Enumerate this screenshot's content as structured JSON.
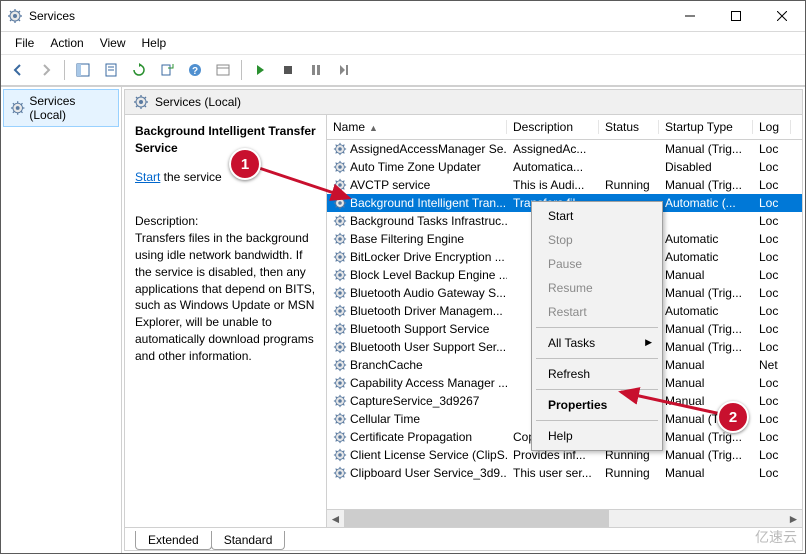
{
  "window": {
    "title": "Services"
  },
  "menubar": [
    "File",
    "Action",
    "View",
    "Help"
  ],
  "tree": {
    "label": "Services (Local)"
  },
  "right_header": "Services (Local)",
  "detail": {
    "selected_name": "Background Intelligent Transfer Service",
    "action_link": "Start",
    "action_suffix": " the service",
    "desc_label": "Description:",
    "description": "Transfers files in the background using idle network bandwidth. If the service is disabled, then any applications that depend on BITS, such as Windows Update or MSN Explorer, will be unable to automatically download programs and other information."
  },
  "columns": {
    "name": "Name",
    "description": "Description",
    "status": "Status",
    "startup": "Startup Type",
    "logon": "Log"
  },
  "services": [
    {
      "name": "AssignedAccessManager Se...",
      "desc": "AssignedAc...",
      "status": "",
      "startup": "Manual (Trig...",
      "logon": "Loc"
    },
    {
      "name": "Auto Time Zone Updater",
      "desc": "Automatica...",
      "status": "",
      "startup": "Disabled",
      "logon": "Loc"
    },
    {
      "name": "AVCTP service",
      "desc": "This is Audi...",
      "status": "Running",
      "startup": "Manual (Trig...",
      "logon": "Loc"
    },
    {
      "name": "Background Intelligent Tran...",
      "desc": "Transfers fil...",
      "status": "",
      "startup": "Automatic (...",
      "logon": "Loc",
      "selected": true
    },
    {
      "name": "Background Tasks Infrastruc...",
      "desc": "",
      "status": "",
      "startup": "",
      "logon": "Loc"
    },
    {
      "name": "Base Filtering Engine",
      "desc": "",
      "status": "",
      "startup": "Automatic",
      "logon": "Loc"
    },
    {
      "name": "BitLocker Drive Encryption ...",
      "desc": "",
      "status": "",
      "startup": "Automatic",
      "logon": "Loc"
    },
    {
      "name": "Block Level Backup Engine ...",
      "desc": "",
      "status": "",
      "startup": "Manual",
      "logon": "Loc"
    },
    {
      "name": "Bluetooth Audio Gateway S...",
      "desc": "",
      "status": "",
      "startup": "Manual (Trig...",
      "logon": "Loc"
    },
    {
      "name": "Bluetooth Driver Managem...",
      "desc": "",
      "status": "",
      "startup": "Automatic",
      "logon": "Loc"
    },
    {
      "name": "Bluetooth Support Service",
      "desc": "",
      "status": "",
      "startup": "Manual (Trig...",
      "logon": "Loc"
    },
    {
      "name": "Bluetooth User Support Ser...",
      "desc": "",
      "status": "",
      "startup": "Manual (Trig...",
      "logon": "Loc"
    },
    {
      "name": "BranchCache",
      "desc": "",
      "status": "",
      "startup": "Manual",
      "logon": "Net"
    },
    {
      "name": "Capability Access Manager ...",
      "desc": "",
      "status": "",
      "startup": "Manual",
      "logon": "Loc"
    },
    {
      "name": "CaptureService_3d9267",
      "desc": "",
      "status": "",
      "startup": "Manual",
      "logon": "Loc"
    },
    {
      "name": "Cellular Time",
      "desc": "",
      "status": "",
      "startup": "Manual (Trig...",
      "logon": "Loc"
    },
    {
      "name": "Certificate Propagation",
      "desc": "Copies user ...",
      "status": "",
      "startup": "Manual (Trig...",
      "logon": "Loc"
    },
    {
      "name": "Client License Service (ClipS...",
      "desc": "Provides inf...",
      "status": "Running",
      "startup": "Manual (Trig...",
      "logon": "Loc"
    },
    {
      "name": "Clipboard User Service_3d9...",
      "desc": "This user ser...",
      "status": "Running",
      "startup": "Manual",
      "logon": "Loc"
    }
  ],
  "context_menu": [
    {
      "label": "Start",
      "enabled": true
    },
    {
      "label": "Stop",
      "enabled": false
    },
    {
      "label": "Pause",
      "enabled": false
    },
    {
      "label": "Resume",
      "enabled": false
    },
    {
      "label": "Restart",
      "enabled": false
    },
    {
      "sep": true
    },
    {
      "label": "All Tasks",
      "enabled": true,
      "submenu": true
    },
    {
      "sep": true
    },
    {
      "label": "Refresh",
      "enabled": true
    },
    {
      "sep": true
    },
    {
      "label": "Properties",
      "enabled": true,
      "bold": true
    },
    {
      "sep": true
    },
    {
      "label": "Help",
      "enabled": true
    }
  ],
  "tabs": {
    "extended": "Extended",
    "standard": "Standard"
  },
  "markers": {
    "m1": "1",
    "m2": "2"
  },
  "watermark": "亿速云"
}
